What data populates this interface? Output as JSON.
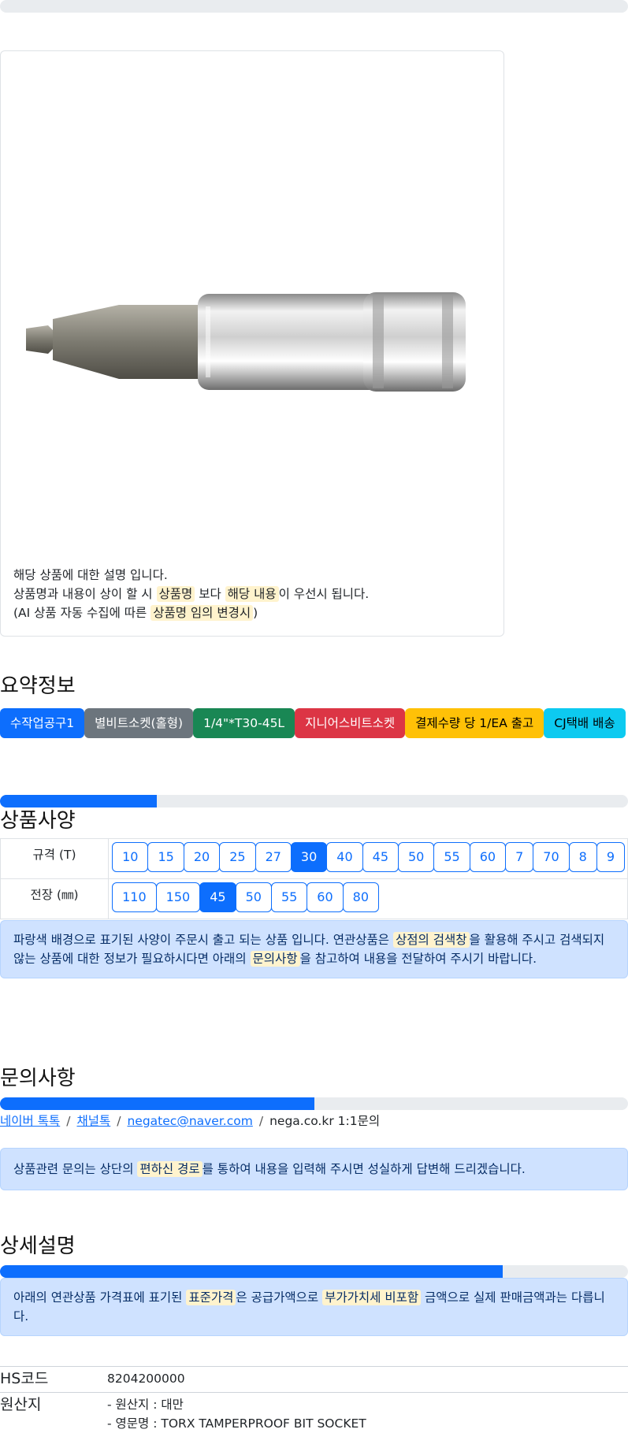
{
  "top_progress": {
    "value": 0
  },
  "product_image": {
    "alt": "TORX TAMPERPROOF BIT SOCKET"
  },
  "notice": {
    "line1": "해당 상품에 대한 설명 입니다.",
    "line2_a": "상품명과 내용이 상이 할 시 ",
    "line2_hl1": "상품명",
    "line2_b": " 보다 ",
    "line2_hl2": "해당 내용",
    "line2_c": "이 우선시 됩니다.",
    "line3_a": "(AI 상품 자동 수집에 따른 ",
    "line3_hl": "상품명 임의 변경시",
    "line3_b": ")"
  },
  "summary": {
    "heading": "요약정보",
    "badges": [
      "수작업공구1",
      "별비트소켓(홀형)",
      "1/4\"*T30-45L",
      "지니어스비트소켓",
      "결제수량 당 1/EA 출고",
      "CJ택배 배송"
    ]
  },
  "spec": {
    "progress": 0.25,
    "heading": "상품사양",
    "rows": [
      {
        "label": "규격 (T)",
        "options": [
          "10",
          "15",
          "20",
          "25",
          "27",
          "30",
          "40",
          "45",
          "50",
          "55",
          "60",
          "7",
          "70",
          "8",
          "9"
        ],
        "selected": "30"
      },
      {
        "label": "전장 (㎜)",
        "options": [
          "110",
          "150",
          "45",
          "50",
          "55",
          "60",
          "80"
        ],
        "selected": "45"
      }
    ],
    "alert_a": "파랑색 배경으로 표기된 사양이 주문시 출고 되는 상품 입니다. 연관상품은 ",
    "alert_hl1": "상점의 검색창",
    "alert_b": "을 활용해 주시고 검색되지 않는 상품에 대한 정보가 필요하시다면 아래의 ",
    "alert_hl2": "문의사항",
    "alert_c": "을 참고하여 내용을 전달하여 주시기 바랍니다."
  },
  "inquiry": {
    "heading": "문의사항",
    "progress": 0.5,
    "links": [
      "네이버 톡톡",
      "채널톡",
      "negatec@naver.com"
    ],
    "plain": "nega.co.kr 1:1문의",
    "separator": "/",
    "alert_a": "상품관련 문의는 상단의 ",
    "alert_hl": "편하신 경로",
    "alert_b": "를 통하여 내용을 입력해 주시면 성실하게 답변해 드리겠습니다."
  },
  "detail": {
    "heading": "상세설명",
    "progress": 0.8,
    "alert_a": "아래의 연관상품 가격표에 표기된 ",
    "alert_hl1": "표준가격",
    "alert_b": "은 공급가액으로 ",
    "alert_hl2": "부가가치세 비포함",
    "alert_c": " 금액으로 실제 판매금액과는 다릅니다.",
    "hs_label": "HS코드",
    "hs_value": "8204200000",
    "origin_label": "원산지",
    "origin_line1": "- 원산지 : 대만",
    "origin_line2": "- 영문명 : TORX TAMPERPROOF BIT SOCKET"
  },
  "colors": {
    "primary": "#0d6efd",
    "alert_bg": "#cfe2ff",
    "highlight": "#fff3cd"
  }
}
